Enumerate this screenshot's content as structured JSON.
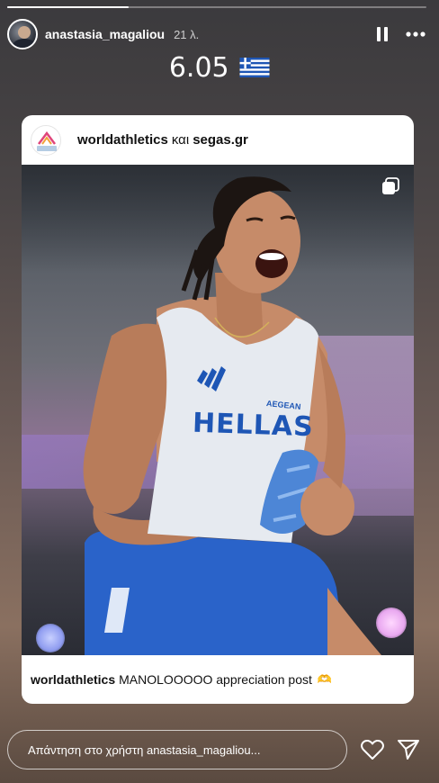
{
  "story": {
    "progress": 0.29,
    "username": "anastasia_magaliou",
    "time": "21 λ.",
    "pause_icon": "pause-icon",
    "more_icon": "more-icon",
    "caption": "6.05",
    "caption_flag": "greek-flag"
  },
  "shared_post": {
    "accounts": {
      "primary": "worldathletics",
      "joiner": "και",
      "secondary": "segas.gr"
    },
    "avatar_icon": "world-athletics-logo",
    "multi_image_icon": "carousel-icon",
    "photo_text": {
      "jersey": "HELLAS",
      "sponsor": "AEGEAN"
    },
    "caption": {
      "username": "worldathletics",
      "text": "MANOLOOOOO appreciation post",
      "emoji": "🫶"
    }
  },
  "reply": {
    "placeholder": "Απάντηση στο χρήστη anastasia_magaliou..."
  },
  "actions": {
    "like_icon": "heart-icon",
    "send_icon": "send-icon"
  },
  "colors": {
    "greek_blue": "#1e56b5",
    "progress": "#ffffff",
    "card_bg": "#ffffff"
  }
}
